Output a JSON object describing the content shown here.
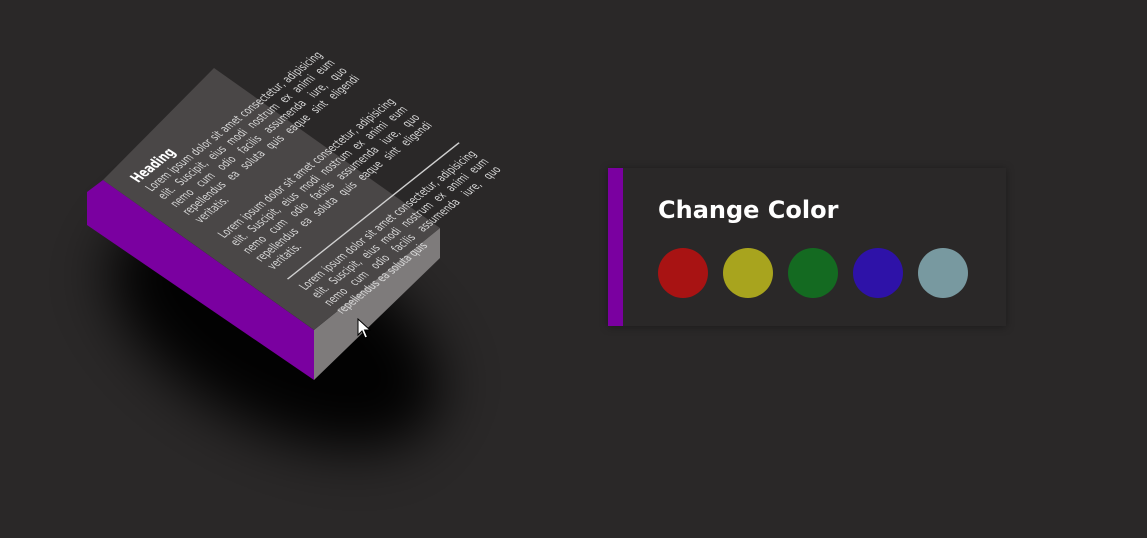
{
  "book": {
    "spine_color": "#7a00a0",
    "top_color": "#4a4747",
    "edge_color": "#7e7b7b",
    "heading": "Heading",
    "paragraphs": [
      "Lorem ipsum dolor sit amet consectetur, adipisicing elit. Suscipit, eius modi nostrum ex animi eum nemo cum odio facilis assumenda iure, quo repellendus ea soluta quis eaque sint eligendi veritatis.",
      "Lorem ipsum dolor sit amet consectetur, adipisicing elit. Suscipit, eius modi nostrum ex animi eum nemo cum odio facilis assumenda iure, quo repellendus ea soluta quis eaque sint eligendi veritatis.",
      "Lorem ipsum dolor sit amet consectetur, adipisicing elit. Suscipit, eius modi nostrum ex animi eum nemo cum odio facilis assumenda iure, quo repellendus ea soluta quis"
    ]
  },
  "panel": {
    "title": "Change Color",
    "accent_color": "#7a00a0",
    "swatches": [
      {
        "name": "red",
        "color": "#a81313"
      },
      {
        "name": "olive",
        "color": "#a8a41e"
      },
      {
        "name": "green",
        "color": "#146a21"
      },
      {
        "name": "indigo",
        "color": "#2e12a8"
      },
      {
        "name": "slate",
        "color": "#7899a0"
      }
    ]
  },
  "icons": {
    "cursor": "cursor-arrow-icon"
  }
}
